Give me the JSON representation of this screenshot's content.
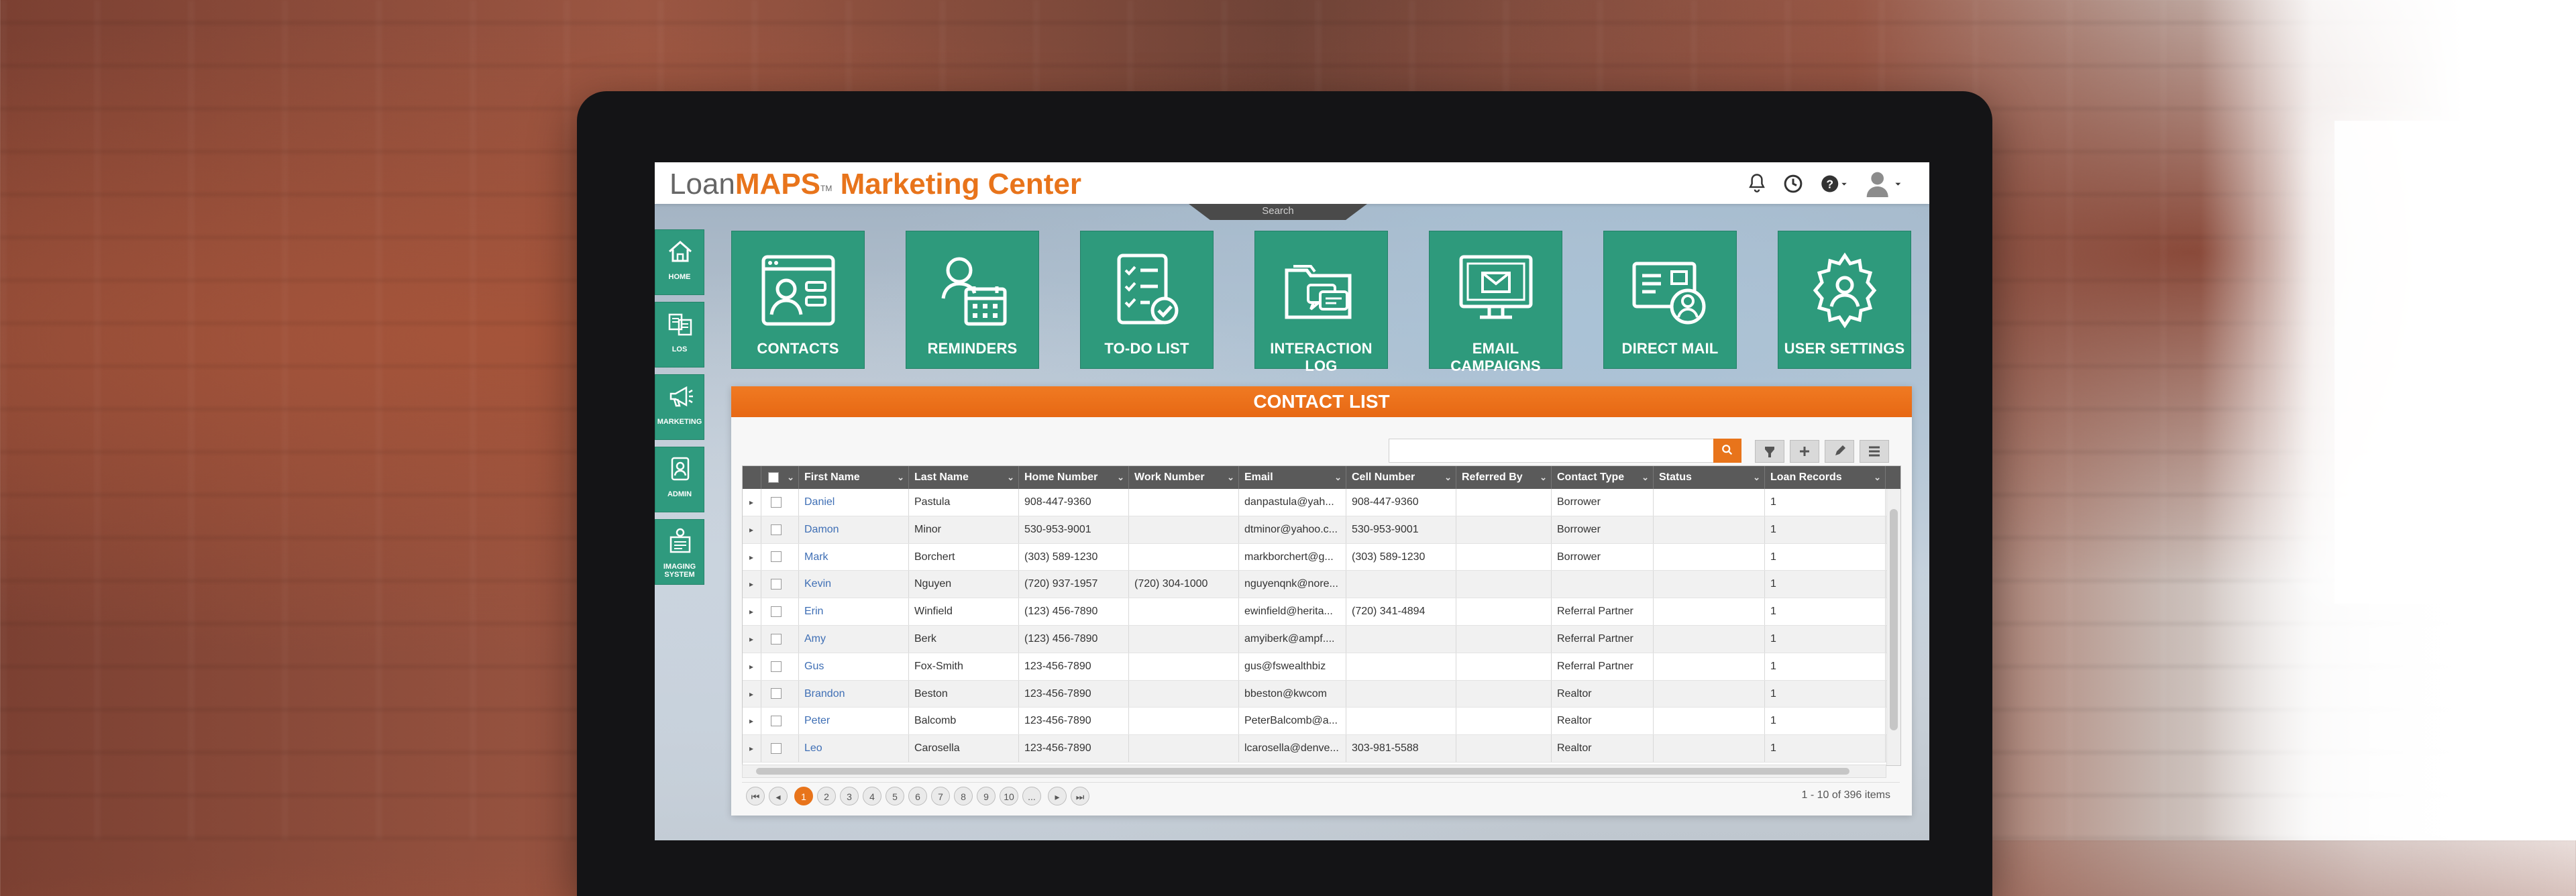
{
  "brand": {
    "part1": "Loan",
    "part2": "MAPS",
    "tm": "TM",
    "part3": " Marketing Center"
  },
  "search_tab_label": "Search",
  "left_nav": [
    {
      "label": "HOME",
      "icon": "home-icon"
    },
    {
      "label": "LOS",
      "icon": "los-icon"
    },
    {
      "label": "MARKETING",
      "icon": "megaphone-icon"
    },
    {
      "label": "ADMIN",
      "icon": "admin-icon"
    },
    {
      "label": "IMAGING SYSTEM",
      "icon": "imaging-icon"
    }
  ],
  "tiles": [
    {
      "label": "CONTACTS",
      "icon": "contacts-icon"
    },
    {
      "label": "REMINDERS",
      "icon": "reminders-icon"
    },
    {
      "label": "TO-DO LIST",
      "icon": "todo-icon"
    },
    {
      "label": "INTERACTION LOG",
      "icon": "interaction-log-icon"
    },
    {
      "label": "EMAIL CAMPAIGNS",
      "icon": "email-campaigns-icon"
    },
    {
      "label": "DIRECT MAIL",
      "icon": "direct-mail-icon"
    },
    {
      "label": "USER SETTINGS",
      "icon": "user-settings-icon"
    }
  ],
  "contact_list": {
    "title": "CONTACT LIST",
    "search": {
      "value": "",
      "placeholder": ""
    },
    "columns": [
      "First Name",
      "Last Name",
      "Home Number",
      "Work Number",
      "Email",
      "Cell Number",
      "Referred By",
      "Contact Type",
      "Status",
      "Loan Records"
    ],
    "rows": [
      [
        "Daniel",
        "Pastula",
        "908-447-9360",
        "",
        "danpastula@yah...",
        "908-447-9360",
        "",
        "Borrower",
        "",
        "1"
      ],
      [
        "Damon",
        "Minor",
        "530-953-9001",
        "",
        "dtminor@yahoo.c...",
        "530-953-9001",
        "",
        "Borrower",
        "",
        "1"
      ],
      [
        "Mark",
        "Borchert",
        "(303) 589-1230",
        "",
        "markborchert@g...",
        "(303) 589-1230",
        "",
        "Borrower",
        "",
        "1"
      ],
      [
        "Kevin",
        "Nguyen",
        "(720) 937-1957",
        "(720) 304-1000",
        "nguyenqnk@nore...",
        "",
        "",
        "",
        "",
        "1"
      ],
      [
        "Erin",
        "Winfield",
        "(123) 456-7890",
        "",
        "ewinfield@herita...",
        "(720) 341-4894",
        "",
        "Referral Partner",
        "",
        "1"
      ],
      [
        "Amy",
        "Berk",
        "(123) 456-7890",
        "",
        "amyiberk@ampf....",
        "",
        "",
        "Referral Partner",
        "",
        "1"
      ],
      [
        "Gus",
        "Fox-Smith",
        "123-456-7890",
        "",
        "gus@fswealthbiz",
        "",
        "",
        "Referral Partner",
        "",
        "1"
      ],
      [
        "Brandon",
        "Beston",
        "123-456-7890",
        "",
        "bbeston@kwcom",
        "",
        "",
        "Realtor",
        "",
        "1"
      ],
      [
        "Peter",
        "Balcomb",
        "123-456-7890",
        "",
        "PeterBalcomb@a...",
        "",
        "",
        "Realtor",
        "",
        "1"
      ],
      [
        "Leo",
        "Carosella",
        "123-456-7890",
        "",
        "lcarosella@denve...",
        "303-981-5588",
        "",
        "Realtor",
        "",
        "1"
      ]
    ],
    "pager": {
      "pages": [
        "1",
        "2",
        "3",
        "4",
        "5",
        "6",
        "7",
        "8",
        "9",
        "10",
        "..."
      ],
      "active_page": "1",
      "info": "1 - 10 of 396 items",
      "first": "⏮",
      "prev": "◂",
      "next": "▸",
      "last": "⏭"
    }
  },
  "colors": {
    "accent": "#e8741b",
    "tile": "#2e9a7c",
    "header": "#5a5a5a",
    "link": "#3f6fb5"
  }
}
